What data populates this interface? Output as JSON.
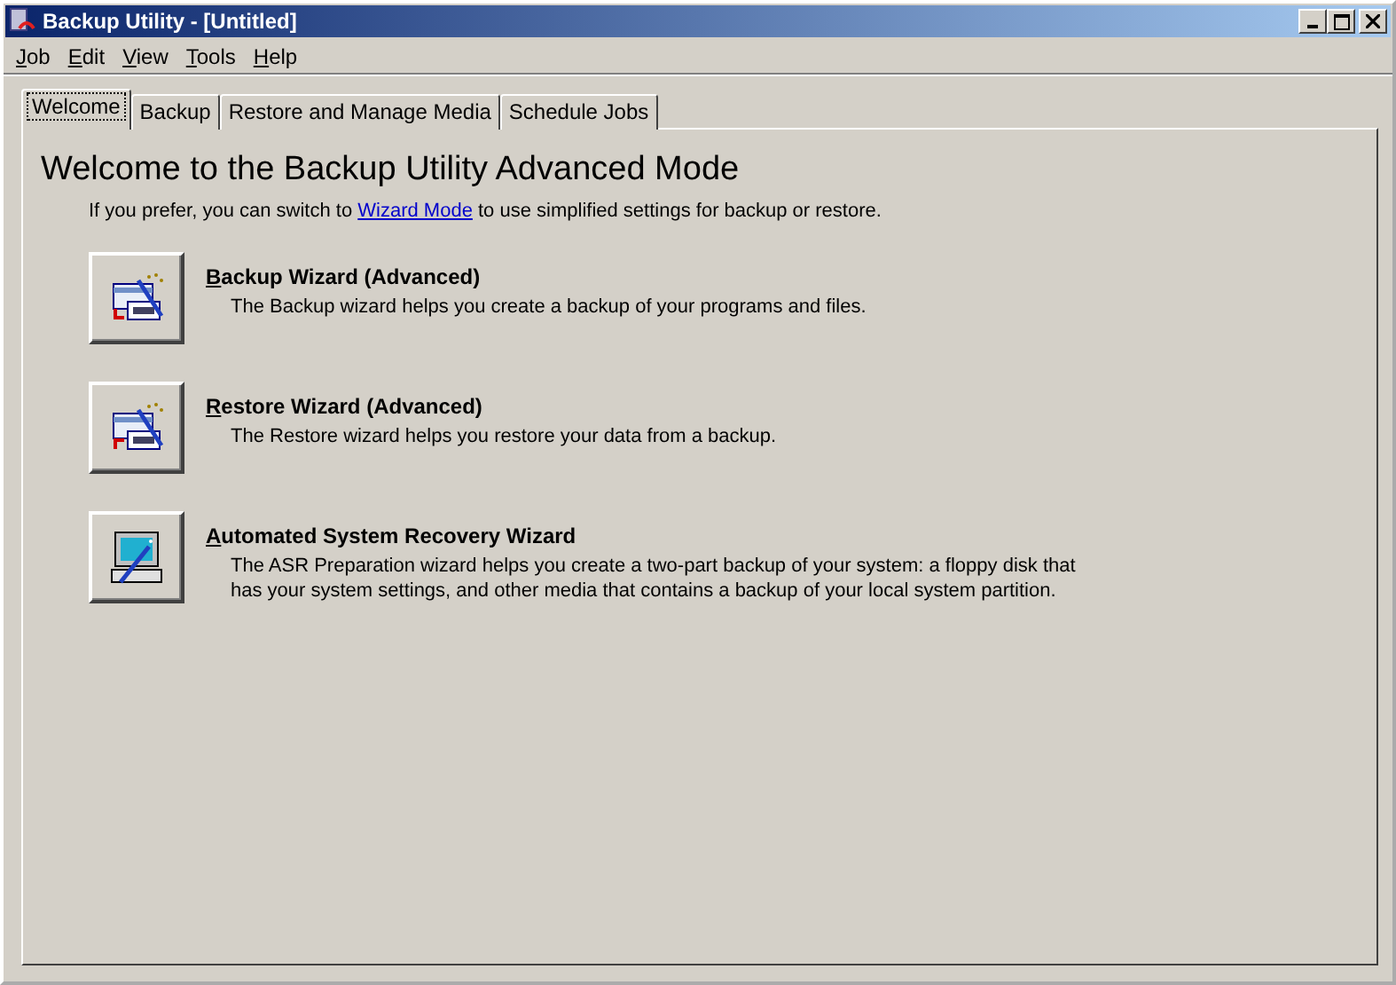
{
  "window": {
    "title": "Backup Utility - [Untitled]"
  },
  "menu": [
    "Job",
    "Edit",
    "View",
    "Tools",
    "Help"
  ],
  "tabs": [
    {
      "label": "Welcome",
      "selected": true
    },
    {
      "label": "Backup",
      "selected": false
    },
    {
      "label": "Restore and Manage Media",
      "selected": false
    },
    {
      "label": "Schedule Jobs",
      "selected": false
    }
  ],
  "heading": "Welcome to the Backup Utility Advanced Mode",
  "intro": {
    "before": "If you prefer, you can switch to",
    "link": "Wizard Mode",
    "after": "to use simplified settings for backup or restore."
  },
  "wizards": [
    {
      "kind": "backup",
      "title": "Backup Wizard (Advanced)",
      "description": "The Backup wizard helps you create a backup of your programs and files."
    },
    {
      "kind": "restore",
      "title": "Restore Wizard (Advanced)",
      "description": "The Restore wizard helps you restore your data from a backup."
    },
    {
      "kind": "asr",
      "title": "Automated System Recovery Wizard",
      "description": "The ASR Preparation wizard helps you create a two-part backup of your system: a floppy disk that has your system settings, and other media that contains a backup of your local system partition."
    }
  ]
}
